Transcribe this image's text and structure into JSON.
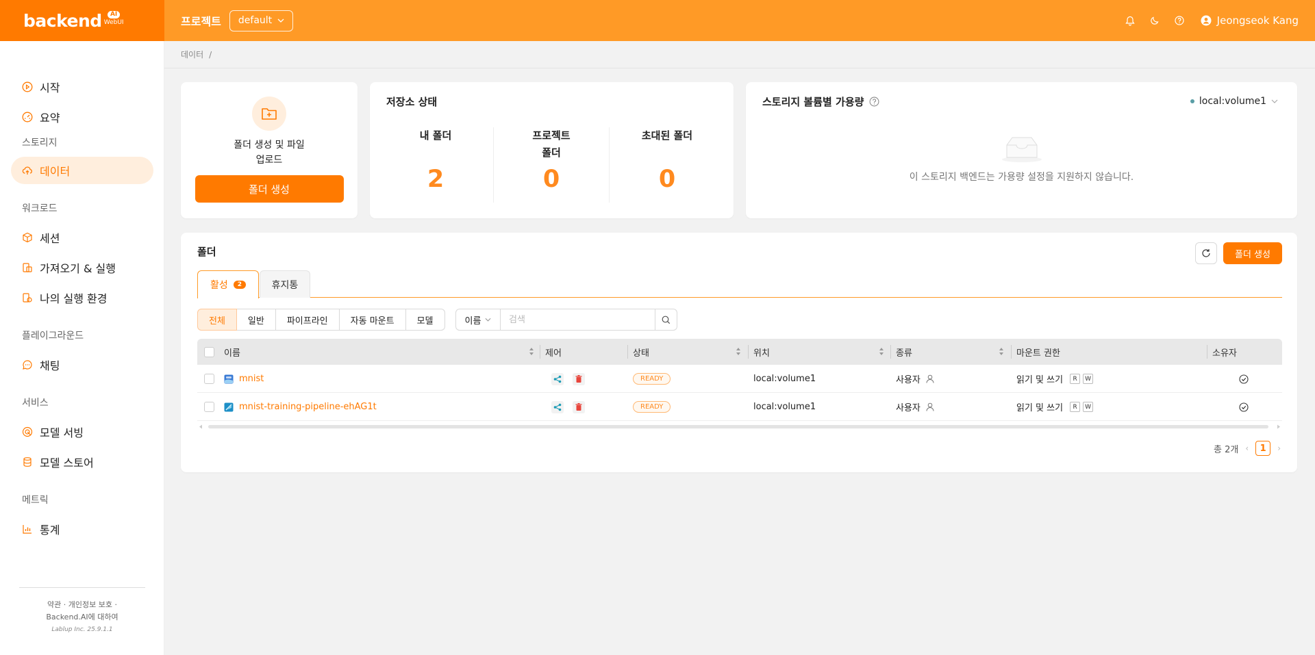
{
  "brand": {
    "name": "backend",
    "tag": "AI",
    "sub": "WebUI"
  },
  "header": {
    "project_label": "프로젝트",
    "project_value": "default",
    "user_name": "Jeongseok Kang"
  },
  "breadcrumb": {
    "current": "데이터",
    "separator": "/"
  },
  "sidebar": {
    "items": [
      {
        "label": "시작",
        "icon": "play-circle-icon"
      },
      {
        "label": "요약",
        "icon": "dashboard-icon"
      },
      {
        "label": "데이터",
        "icon": "cloud-upload-icon"
      },
      {
        "label": "세션",
        "icon": "box-icon"
      },
      {
        "label": "가져오기 & 실행",
        "icon": "import-icon"
      },
      {
        "label": "나의 실행 환경",
        "icon": "environment-icon"
      },
      {
        "label": "채팅",
        "icon": "chat-icon"
      },
      {
        "label": "모델 서빙",
        "icon": "serving-icon"
      },
      {
        "label": "모델 스토어",
        "icon": "database-icon"
      },
      {
        "label": "통계",
        "icon": "bar-chart-icon"
      }
    ],
    "sections": [
      "스토리지",
      "워크로드",
      "플레이그라운드",
      "서비스",
      "메트릭"
    ],
    "footer": {
      "links": "약관 · 개인정보 보호 ·",
      "about": "Backend.AI에 대하여",
      "copyright": "Lablup Inc. 25.9.1.1"
    }
  },
  "create_card": {
    "text": "폴더 생성 및 파일 업로드",
    "button": "폴더 생성"
  },
  "storage_status": {
    "title": "저장소 상태",
    "stats": [
      {
        "label": "내 폴더",
        "value": "2"
      },
      {
        "label": "프로젝트 폴더",
        "value": "0"
      },
      {
        "label": "초대된 폴더",
        "value": "0"
      }
    ]
  },
  "quota": {
    "title": "스토리지 볼륨별 가용량",
    "volume": "local:volume1",
    "empty_text": "이 스토리지 백엔드는 가용량 설정을 지원하지 않습니다."
  },
  "folders": {
    "title": "폴더",
    "create_button": "폴더 생성",
    "tabs": {
      "active": "활성",
      "active_count": "2",
      "trash": "휴지통"
    },
    "filters": [
      "전체",
      "일반",
      "파이프라인",
      "자동 마운트",
      "모델"
    ],
    "search": {
      "field": "이름",
      "placeholder": "검색"
    },
    "columns": [
      "이름",
      "제어",
      "상태",
      "위치",
      "종류",
      "마운트 권한",
      "소유자"
    ],
    "rows": [
      {
        "name": "mnist",
        "status": "READY",
        "location": "local:volume1",
        "type": "사용자",
        "permission": "읽기 및 쓰기",
        "perm_r": "R",
        "perm_w": "W"
      },
      {
        "name": "mnist-training-pipeline-ehAG1t",
        "status": "READY",
        "location": "local:volume1",
        "type": "사용자",
        "permission": "읽기 및 쓰기",
        "perm_r": "R",
        "perm_w": "W"
      }
    ],
    "pagination": {
      "total": "총 2개",
      "page": "1"
    }
  }
}
